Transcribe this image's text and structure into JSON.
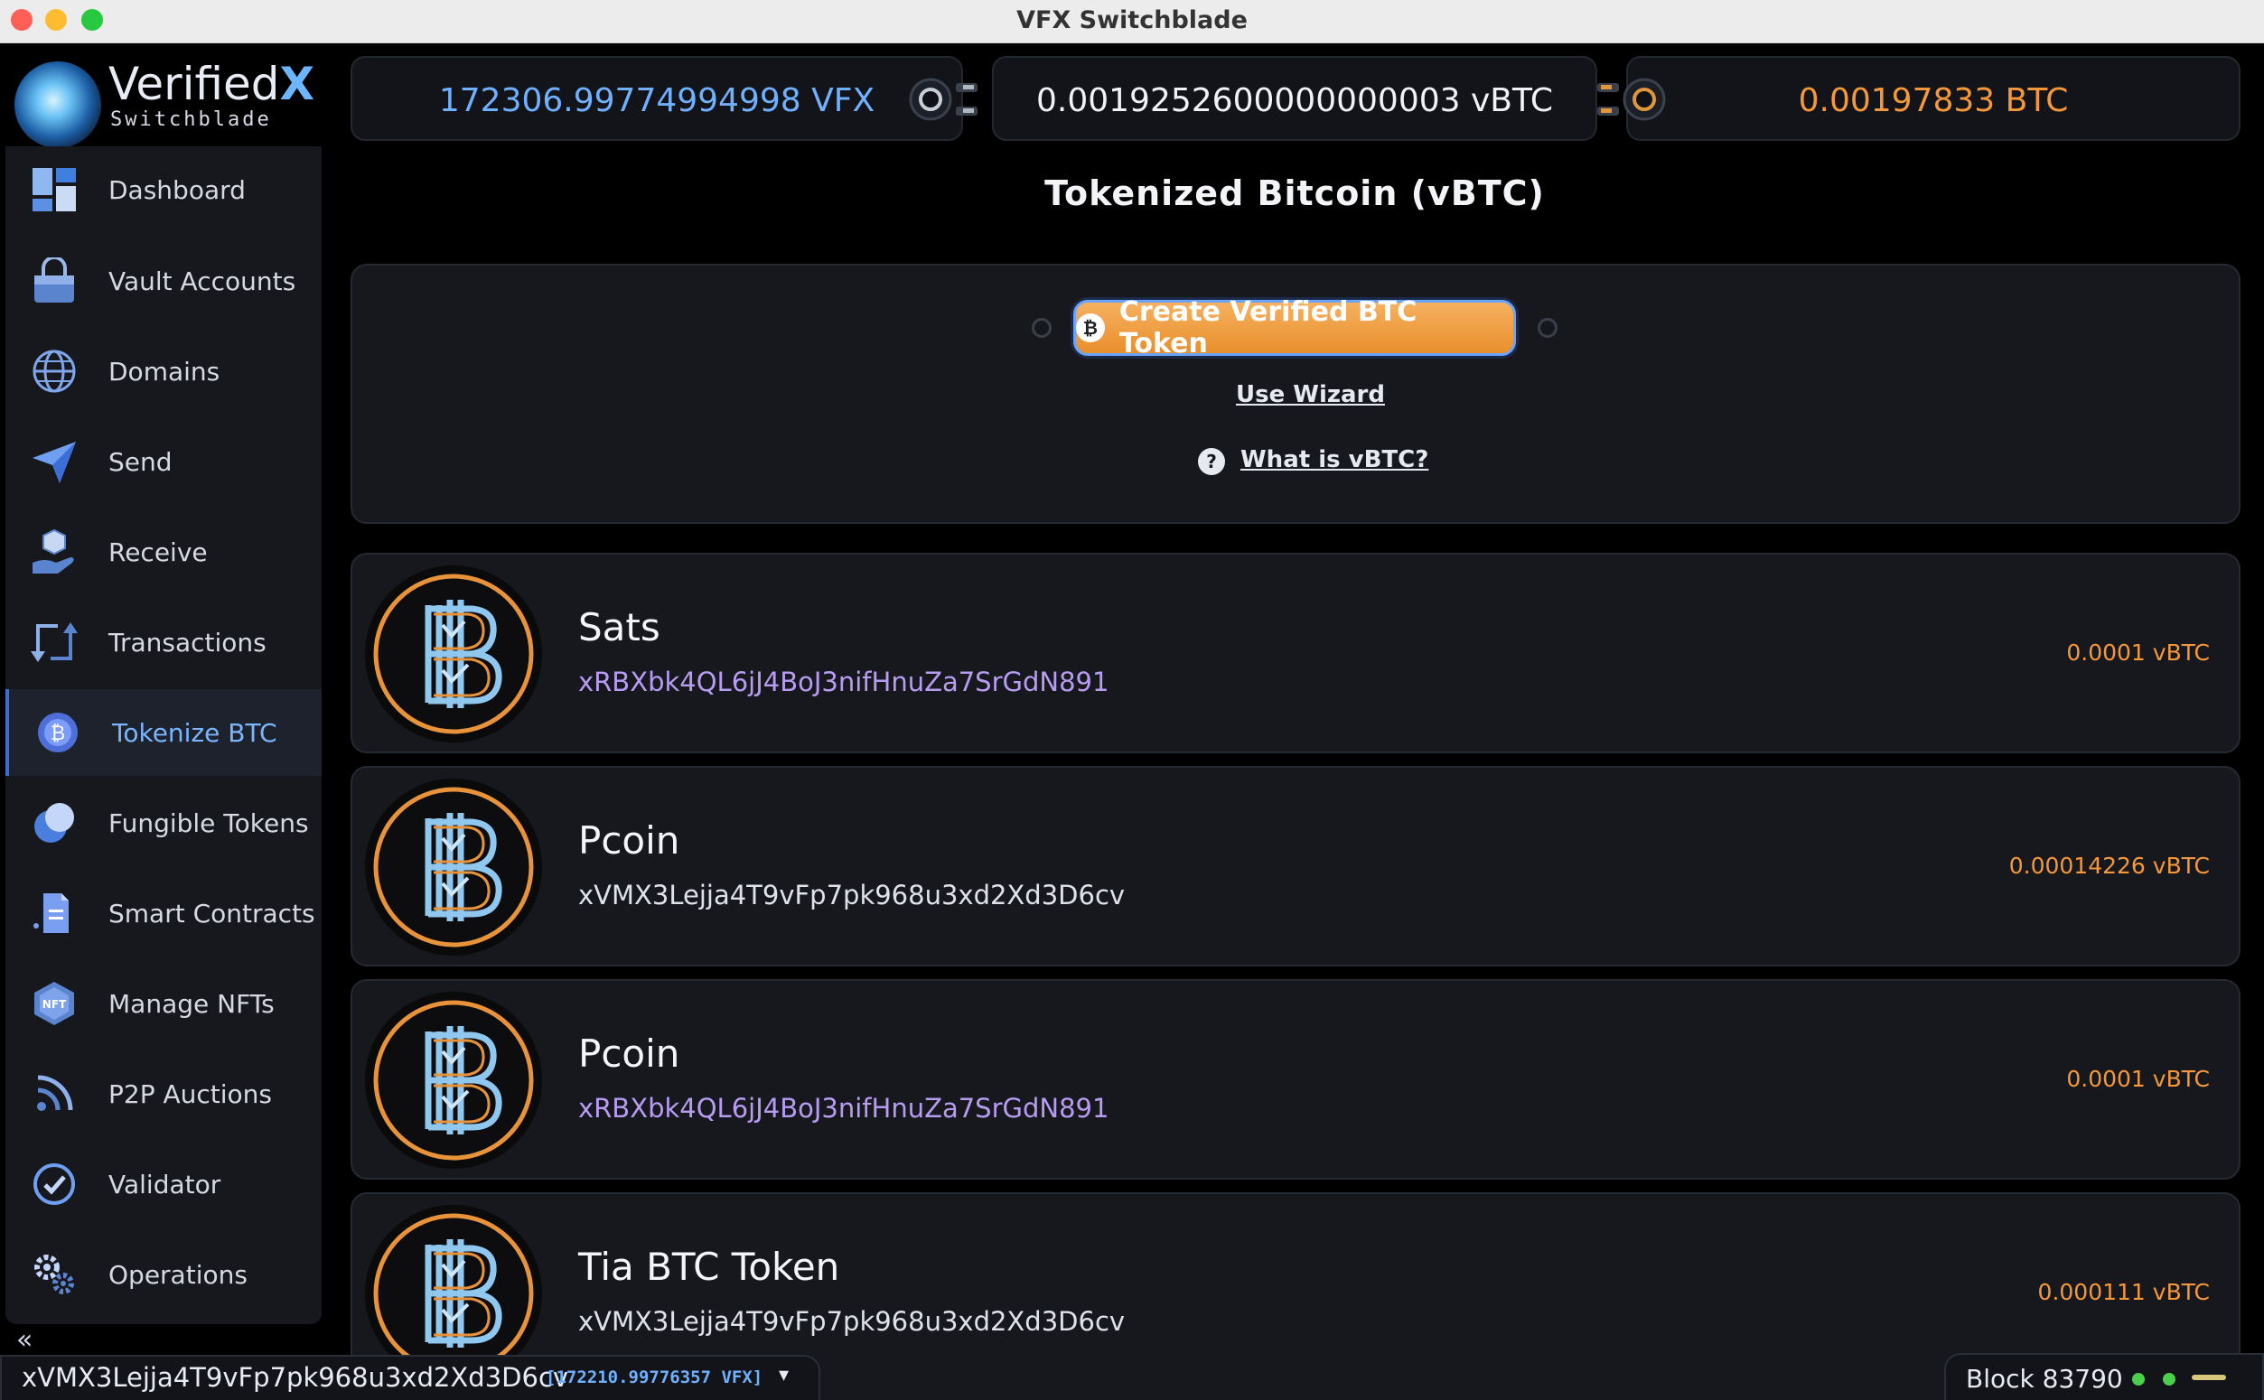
{
  "window": {
    "title": "VFX Switchblade"
  },
  "brand": {
    "name_main": "Verified",
    "name_accent": "X",
    "subtitle": "Switchblade"
  },
  "balances": {
    "vfx": "172306.99774994998 VFX",
    "vbtc": "0.0019252600000000003 vBTC",
    "btc": "0.00197833 BTC"
  },
  "sidebar": {
    "items": [
      {
        "label": "Dashboard",
        "icon": "dashboard-icon"
      },
      {
        "label": "Vault Accounts",
        "icon": "vault-icon"
      },
      {
        "label": "Domains",
        "icon": "globe-icon"
      },
      {
        "label": "Send",
        "icon": "paper-plane-icon"
      },
      {
        "label": "Receive",
        "icon": "receive-icon"
      },
      {
        "label": "Transactions",
        "icon": "transactions-icon"
      },
      {
        "label": "Tokenize BTC",
        "icon": "bitcoin-icon",
        "active": true
      },
      {
        "label": "Fungible Tokens",
        "icon": "fungible-tokens-icon"
      },
      {
        "label": "Smart Contracts",
        "icon": "smart-contract-icon"
      },
      {
        "label": "Manage NFTs",
        "icon": "nft-icon"
      },
      {
        "label": "P2P Auctions",
        "icon": "auction-icon"
      },
      {
        "label": "Validator",
        "icon": "validator-check-icon"
      },
      {
        "label": "Operations",
        "icon": "gears-icon"
      }
    ],
    "collapse": "«"
  },
  "main": {
    "title": "Tokenized Bitcoin (vBTC)",
    "create_button": "Create Verified BTC Token",
    "create_button_coin": "₿",
    "use_wizard": "Use Wizard",
    "help_icon": "?",
    "what_is": "What is vBTC?"
  },
  "tokens": [
    {
      "name": "Sats",
      "address": "xRBXbk4QL6jJ4BoJ3nifHnuZa7SrGdN891",
      "amount": "0.0001 vBTC"
    },
    {
      "name": "Pcoin",
      "address": "xVMX3Lejja4T9vFp7pk968u3xd2Xd3D6cv",
      "amount": "0.00014226 vBTC"
    },
    {
      "name": "Pcoin",
      "address": "xRBXbk4QL6jJ4BoJ3nifHnuZa7SrGdN891",
      "amount": "0.0001 vBTC"
    },
    {
      "name": "Tia BTC Token",
      "address": "xVMX3Lejja4T9vFp7pk968u3xd2Xd3D6cv",
      "amount": "0.000111 vBTC"
    }
  ],
  "status": {
    "address": "xVMX3Lejja4T9vFp7pk968u3xd2Xd3D6cv",
    "address_balance": "[172210.99776357 VFX]",
    "caret": "▾",
    "block": "Block 83790"
  },
  "colors": {
    "accent_blue": "#6fb1ff",
    "btc_orange": "#f5983a",
    "address_purple": "#b79cf2",
    "status_green": "#4ad04a"
  }
}
